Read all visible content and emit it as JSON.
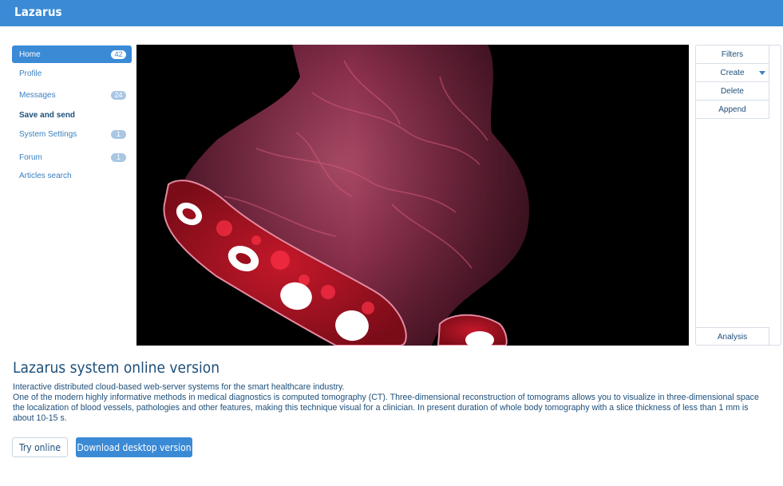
{
  "app": {
    "brand": "Lazarus"
  },
  "sidebar": {
    "items": [
      {
        "label": "Home",
        "badge": "42"
      },
      {
        "label": "Profile",
        "badge": ""
      },
      {
        "label": "Messages",
        "badge": "24"
      },
      {
        "label": "Save and send",
        "badge": ""
      },
      {
        "label": "System Settings",
        "badge": "1"
      },
      {
        "label": "Forum",
        "badge": "1"
      },
      {
        "label": "Articles search",
        "badge": ""
      }
    ]
  },
  "toolbar": {
    "filters": "Filters",
    "create": "Create",
    "delete": "Delete",
    "append": "Append",
    "analysis": "Analysis"
  },
  "main": {
    "title": "Lazarus system online version",
    "desc1": "Interactive distributed cloud-based web-server systems for the smart healthcare industry.",
    "desc2": "One of the modern highly informative methods in medical diagnostics is computed tomography (CT). Three-dimensional reconstruction of tomograms allows you to visualize in three-dimensional space the localization of blood vessels, pathologies and other features, making this technique visual for a clinician. In present duration of whole body tomography with a slice thickness of less than 1 mm is about 10-15 s.",
    "try_online": "Try online",
    "download": "Download desktop version"
  },
  "colors": {
    "brand": "#3a8ad6",
    "text": "#1d4f7a",
    "badge": "#a9c6e3"
  }
}
